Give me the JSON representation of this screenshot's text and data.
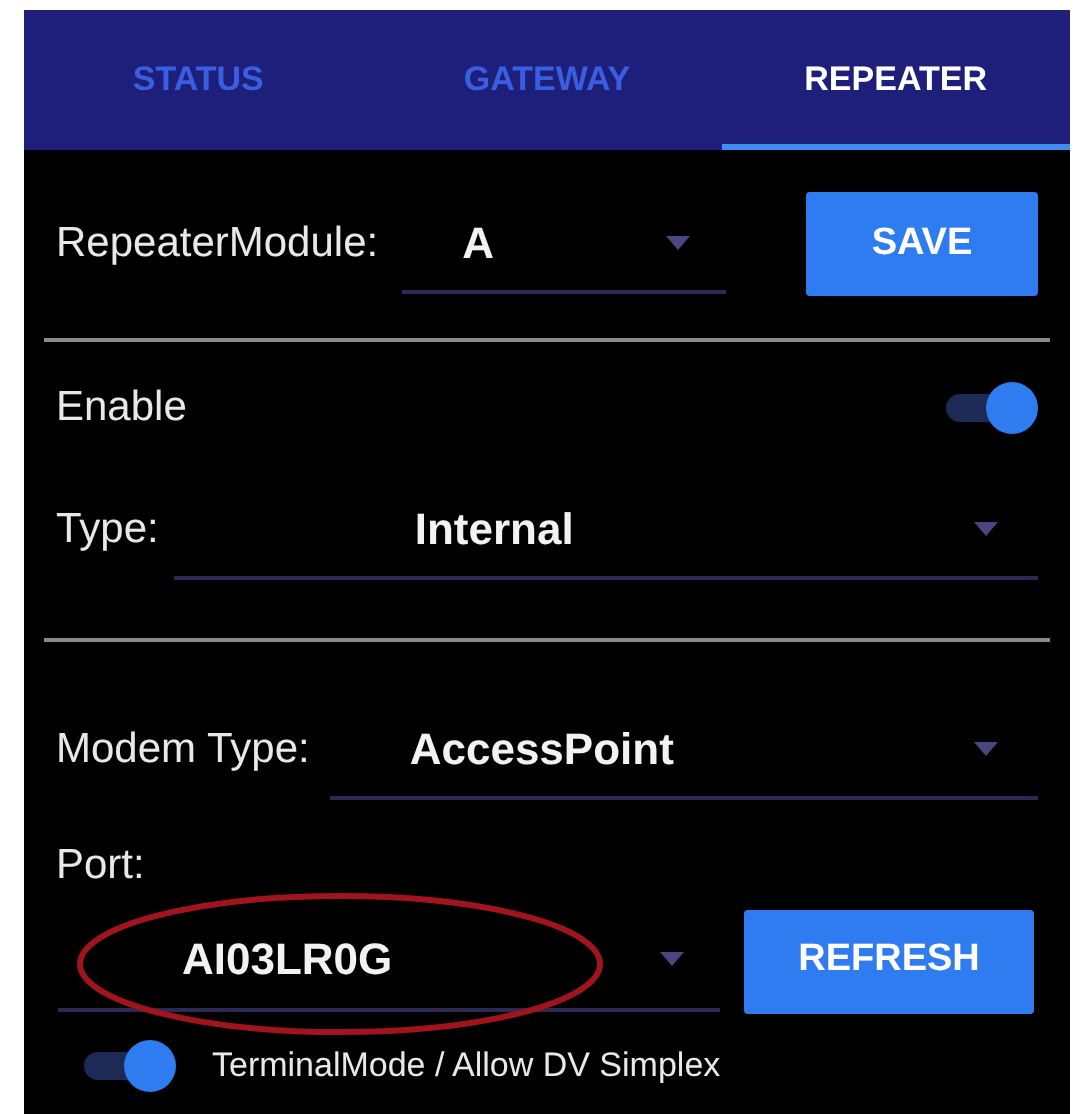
{
  "tabs": [
    {
      "label": "STATUS",
      "selected": false
    },
    {
      "label": "GATEWAY",
      "selected": false
    },
    {
      "label": "REPEATER",
      "selected": true
    }
  ],
  "repeater_module": {
    "label": "RepeaterModule:",
    "value": "A",
    "button": "SAVE"
  },
  "enable": {
    "label": "Enable",
    "on": true
  },
  "type": {
    "label": "Type:",
    "value": "Internal"
  },
  "modem_type": {
    "label": "Modem Type:",
    "value": "AccessPoint"
  },
  "port": {
    "label": "Port:",
    "value": "AI03LR0G",
    "button": "REFRESH",
    "highlighted": true
  },
  "terminal_mode": {
    "label": "TerminalMode / Allow DV Simplex",
    "on": true
  }
}
